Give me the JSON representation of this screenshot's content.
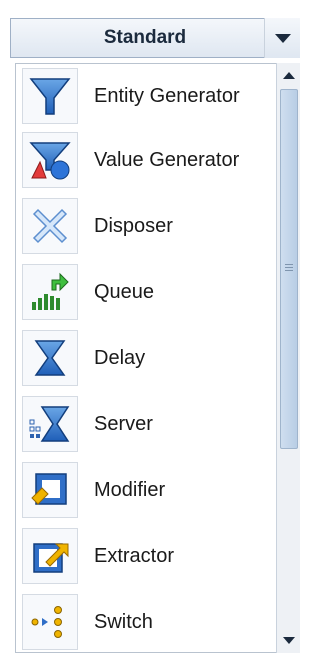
{
  "palette": {
    "header_title": "Standard",
    "items": [
      {
        "label": "Entity Generator",
        "icon": "funnel-icon"
      },
      {
        "label": "Value Generator",
        "icon": "value-generator-icon"
      },
      {
        "label": "Disposer",
        "icon": "disposer-x-icon"
      },
      {
        "label": "Queue",
        "icon": "queue-icon"
      },
      {
        "label": "Delay",
        "icon": "hourglass-icon"
      },
      {
        "label": "Server",
        "icon": "server-hourglass-icon"
      },
      {
        "label": "Modifier",
        "icon": "modifier-icon"
      },
      {
        "label": "Extractor",
        "icon": "extractor-icon"
      },
      {
        "label": "Switch",
        "icon": "switch-icon"
      }
    ]
  }
}
